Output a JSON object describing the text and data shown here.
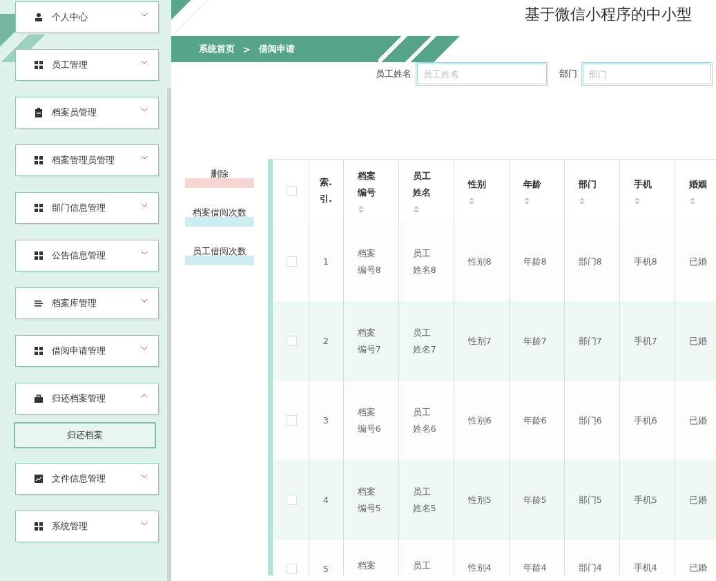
{
  "sidebar": {
    "items": [
      {
        "label": "个人中心",
        "expanded": false
      },
      {
        "label": "员工管理",
        "expanded": false
      },
      {
        "label": "档案员管理",
        "expanded": false
      },
      {
        "label": "档案管理员管理",
        "expanded": false
      },
      {
        "label": "部门信息管理",
        "expanded": false
      },
      {
        "label": "公告信息管理",
        "expanded": false
      },
      {
        "label": "档案库管理",
        "expanded": false
      },
      {
        "label": "借阅申请管理",
        "expanded": false
      },
      {
        "label": "归还档案管理",
        "expanded": true,
        "children": [
          {
            "label": "归还档案"
          }
        ]
      },
      {
        "label": "文件信息管理",
        "expanded": false
      },
      {
        "label": "系统管理",
        "expanded": false
      }
    ]
  },
  "header": {
    "title": "基于微信小程序的中小型"
  },
  "breadcrumb": [
    "系统首页",
    ">",
    "借阅申请"
  ],
  "search": [
    {
      "label": "员工姓名",
      "placeholder": "员工姓名"
    },
    {
      "label": "部门",
      "placeholder": "部门"
    }
  ],
  "actions": [
    {
      "label": "删除",
      "kind": "danger"
    },
    {
      "label": "档案借阅次数",
      "kind": "info"
    },
    {
      "label": "员工借阅次数",
      "kind": "info"
    }
  ],
  "table": {
    "select_all_checked": false,
    "columns": [
      "索.引.",
      "档案编号",
      "员工姓名",
      "性别",
      "年龄",
      "部门",
      "手机",
      "婚姻"
    ],
    "rows": [
      {
        "checked": false,
        "cells": [
          "1",
          "档案编号8",
          "员工姓名8",
          "性别8",
          "年龄8",
          "部门8",
          "手机8",
          "已婚"
        ]
      },
      {
        "checked": false,
        "cells": [
          "2",
          "档案编号7",
          "员工姓名7",
          "性别7",
          "年龄7",
          "部门7",
          "手机7",
          "已婚"
        ]
      },
      {
        "checked": false,
        "cells": [
          "3",
          "档案编号6",
          "员工姓名6",
          "性别6",
          "年龄6",
          "部门6",
          "手机6",
          "已婚"
        ]
      },
      {
        "checked": false,
        "cells": [
          "4",
          "档案编号5",
          "员工姓名5",
          "性别5",
          "年龄5",
          "部门5",
          "手机5",
          "已婚"
        ]
      },
      {
        "checked": false,
        "cells": [
          "5",
          "档案",
          "员工",
          "性别4",
          "年龄4",
          "部门4",
          "手机4",
          "已婚"
        ]
      }
    ]
  }
}
